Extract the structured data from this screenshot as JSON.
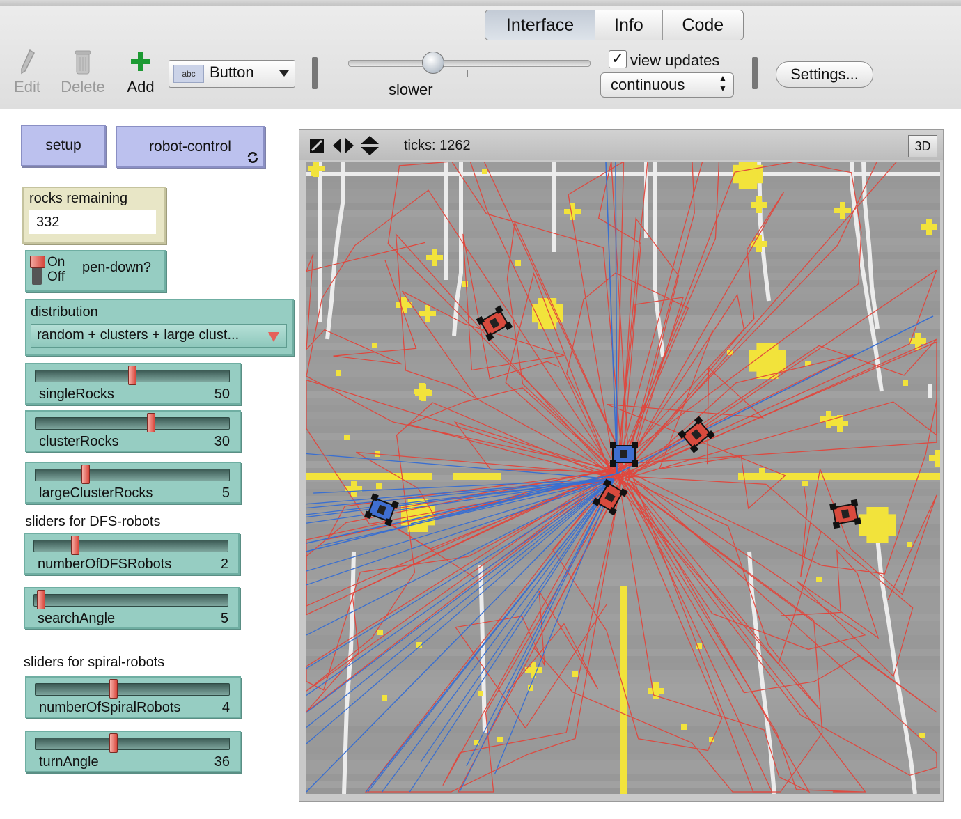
{
  "tabs": [
    "Interface",
    "Info",
    "Code"
  ],
  "toolbar": {
    "edit": "Edit",
    "delete": "Delete",
    "add": "Add",
    "widget_type": "Button",
    "widget_icon_text": "abc",
    "speed_label": "slower",
    "view_updates_label": "view updates",
    "view_updates_checked": true,
    "update_mode": "continuous",
    "settings": "Settings..."
  },
  "buttons": {
    "setup": "setup",
    "robot_control": "robot-control",
    "robot_control_forever_icon": "forever-arrows-icon"
  },
  "monitor": {
    "label": "rocks remaining",
    "value": "332"
  },
  "switch": {
    "on": "On",
    "off": "Off",
    "label": "pen-down?",
    "state": "off"
  },
  "chooser": {
    "label": "distribution",
    "value": "random + clusters + large clust..."
  },
  "sliders": [
    {
      "name": "singleRocks",
      "value": "50",
      "fraction": 0.5
    },
    {
      "name": "clusterRocks",
      "value": "30",
      "fraction": 0.6
    },
    {
      "name": "largeClusterRocks",
      "value": "5",
      "fraction": 0.25
    },
    {
      "name": "numberOfDFSRobots",
      "value": "2",
      "fraction": 0.2
    },
    {
      "name": "searchAngle",
      "value": "5",
      "fraction": 0.02
    },
    {
      "name": "numberOfSpiralRobots",
      "value": "4",
      "fraction": 0.4
    },
    {
      "name": "turnAngle",
      "value": "36",
      "fraction": 0.4
    }
  ],
  "notes": {
    "dfs": "sliders for DFS-robots",
    "spiral": "sliders for spiral-robots"
  },
  "view": {
    "ticks": "ticks: 1262",
    "btn3d": "3D"
  },
  "colors": {
    "button_bg": "#bcc1ee",
    "widget_teal": "#96cdc2",
    "monitor_bg": "#e8e6c6",
    "rock_yellow": "#f2e33b",
    "red_trail": "#e0463c",
    "blue_trail": "#3a6fd0",
    "world_gray": "#9c9c9c"
  }
}
